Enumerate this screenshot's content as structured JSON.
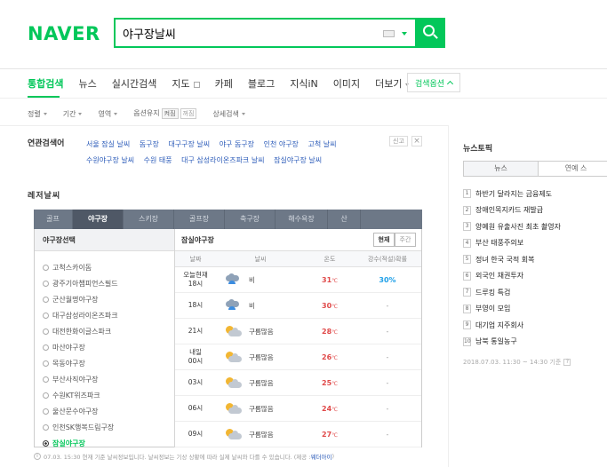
{
  "header": {
    "logo": "NAVER",
    "query": "야구장날씨"
  },
  "tabs": {
    "items": [
      "통합검색",
      "뉴스",
      "실시간검색",
      "지도",
      "카페",
      "블로그",
      "지식iN",
      "이미지",
      "더보기"
    ],
    "search_options": "검색옵션"
  },
  "filters": {
    "sort": "정렬",
    "period": "기간",
    "area": "영역",
    "option_keep": "옵션유지",
    "on": "켜짐",
    "off": "꺼짐",
    "detail": "상세검색"
  },
  "related": {
    "title": "연관검색어",
    "row1": [
      "서울 잠실 날씨",
      "돔구장",
      "대구구장 날씨",
      "야구 돔구장",
      "인천 야구장",
      "고척 날씨"
    ],
    "row2": [
      "수원야구장 날씨",
      "수원 태풍",
      "대구 삼성라이온즈파크 날씨",
      "잠실야구장 날씨"
    ],
    "report": "신고",
    "close": "×"
  },
  "weather": {
    "title": "레저날씨",
    "tabs": [
      "골프",
      "야구장",
      "스키장",
      "골프장",
      "축구장",
      "해수욕장",
      "산"
    ],
    "select_title": "야구장선택",
    "stadiums": [
      "고척스카이돔",
      "광주기아챔피언스필드",
      "군산월명야구장",
      "대구삼성라이온즈파크",
      "대전한화이글스파크",
      "마산야구장",
      "목동야구장",
      "부산사직야구장",
      "수원KT위즈파크",
      "울산문수야구장",
      "인천SK행복드림구장",
      "잠실야구장"
    ],
    "selected_stadium": "잠실야구장",
    "view_now": "현재",
    "view_week": "주간",
    "columns": {
      "date": "날짜",
      "weather": "날씨",
      "temp": "온도",
      "rain": "강수(적설)확률"
    },
    "rows": [
      {
        "time1": "오늘현재",
        "time2": "18시",
        "icon": "rain-icon",
        "desc": "비",
        "temp": "31",
        "rain": "30%"
      },
      {
        "time1": "",
        "time2": "18시",
        "icon": "rain-icon",
        "desc": "비",
        "temp": "30",
        "rain": "-"
      },
      {
        "time1": "",
        "time2": "21시",
        "icon": "cloudy-icon",
        "desc": "구름많음",
        "temp": "28",
        "rain": "-"
      },
      {
        "time1": "내일",
        "time2": "00시",
        "icon": "cloudy-icon",
        "desc": "구름많음",
        "temp": "26",
        "rain": "-"
      },
      {
        "time1": "",
        "time2": "03시",
        "icon": "cloudy-icon",
        "desc": "구름많음",
        "temp": "25",
        "rain": "-"
      },
      {
        "time1": "",
        "time2": "06시",
        "icon": "cloudy-icon",
        "desc": "구름많음",
        "temp": "24",
        "rain": "-"
      },
      {
        "time1": "",
        "time2": "09시",
        "icon": "cloudy-icon",
        "desc": "구름많음",
        "temp": "27",
        "rain": "-"
      }
    ],
    "temp_unit": "℃",
    "footnote": "07.03. 15:30 현재 기준 날씨정보입니다. 날씨정보는 기상 상황에 따라 실제 날씨와 다를 수 있습니다. (제공 : ",
    "footnote_source": "웨더아이",
    "footnote_end": ")"
  },
  "news_topic": {
    "title": "뉴스토픽",
    "tabs": [
      "뉴스",
      "연예 스"
    ],
    "items": [
      "하반기 달라지는 금융제도",
      "장애인목지카드 재발급",
      "양예원 유출사진 최초 촬영자",
      "부산 태풍주의보",
      "정녀 한국 국적 회복",
      "외국인 채권투자",
      "드루킹 특검",
      "부영이 모임",
      "대기업 지주회사",
      "남북 통일농구"
    ],
    "time": "2018.07.03. 11:30 ~ 14:30 기준",
    "help": "?"
  },
  "colors": {
    "brand": "#03c75a",
    "weather_tab_bg": "#6d7887",
    "temp": "#e04a4a",
    "rain_pct": "#1fa0e8",
    "link": "#2a5ab8"
  }
}
